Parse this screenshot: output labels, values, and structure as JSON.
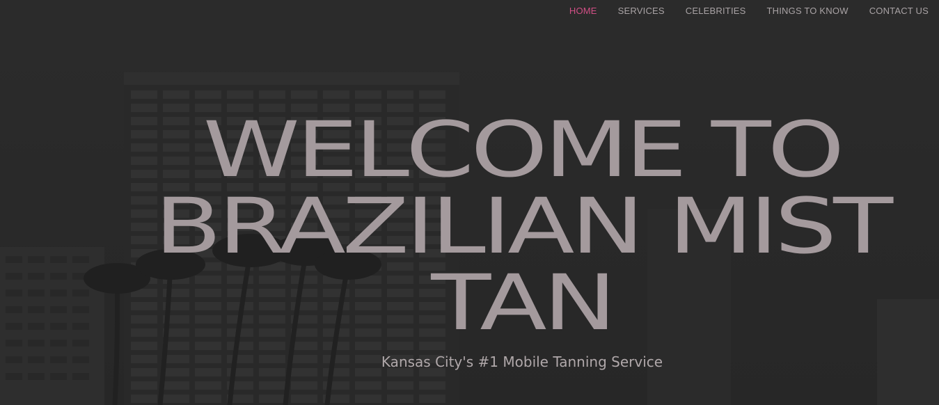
{
  "nav": {
    "items": [
      {
        "label": "HOME",
        "active": true
      },
      {
        "label": "SERVICES",
        "active": false
      },
      {
        "label": "CELEBRITIES",
        "active": false
      },
      {
        "label": "THINGS TO KNOW",
        "active": false
      },
      {
        "label": "CONTACT US",
        "active": false
      }
    ],
    "active_color": "#d24f86",
    "color": "#a9a3a5"
  },
  "hero": {
    "title_lines": [
      "WELCOME TO",
      "BRAZILIAN MIST",
      "TAN"
    ],
    "subtitle": "Kansas City's #1 Mobile Tanning Service",
    "title_color": "#a49a9d"
  }
}
